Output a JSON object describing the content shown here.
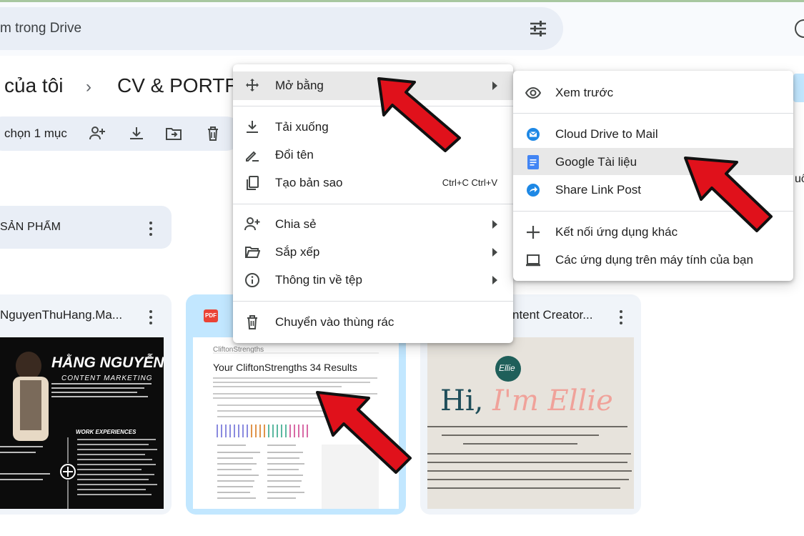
{
  "search": {
    "placeholder_tail": "m trong Drive"
  },
  "breadcrumb": {
    "parent": "của tôi",
    "separator": "›",
    "current": "CV & PORTF"
  },
  "toolbar": {
    "selected_label": "chọn 1 mục"
  },
  "folder": {
    "name": "SẢN PHẨM"
  },
  "files": [
    {
      "name": "NguyenThuHang.Ma..."
    },
    {
      "name": "",
      "type_badge": "PDF"
    },
    {
      "name": "ntent Creator..."
    }
  ],
  "thumb1": {
    "heading": "HẰNG NGUYỄN",
    "subheading": "CONTENT MARKETING",
    "section": "WORK EXPERIENCES"
  },
  "thumb2": {
    "brand": "CliftonStrengths",
    "title": "Your CliftonStrengths 34 Results"
  },
  "thumb3": {
    "logo": "Ellie",
    "greeting_a": "Hi, ",
    "greeting_b": "I'm Ellie"
  },
  "context_menu": {
    "items": [
      {
        "label": "Mở bằng",
        "submenu": true
      },
      {
        "label": "Tải xuống"
      },
      {
        "label": "Đổi tên"
      },
      {
        "label": "Tạo bản sao",
        "shortcut": "Ctrl+C Ctrl+V"
      },
      {
        "label": "Chia sẻ",
        "submenu": true
      },
      {
        "label": "Sắp xếp",
        "submenu": true
      },
      {
        "label": "Thông tin về tệp",
        "submenu": true
      },
      {
        "label": "Chuyển vào thùng rác"
      }
    ]
  },
  "open_with_menu": {
    "items": [
      {
        "label": "Xem trước"
      },
      {
        "label": "Cloud Drive to Mail"
      },
      {
        "label": "Google Tài liệu"
      },
      {
        "label": "Share Link Post"
      },
      {
        "label": "Kết nối ứng dụng khác"
      },
      {
        "label": "Các ứng dụng trên máy tính của bạn"
      }
    ]
  },
  "edge_text": "uố",
  "colors": {
    "arrow": "#e0111b",
    "docs_blue": "#4285f4",
    "selected_card": "#c2e7ff"
  }
}
